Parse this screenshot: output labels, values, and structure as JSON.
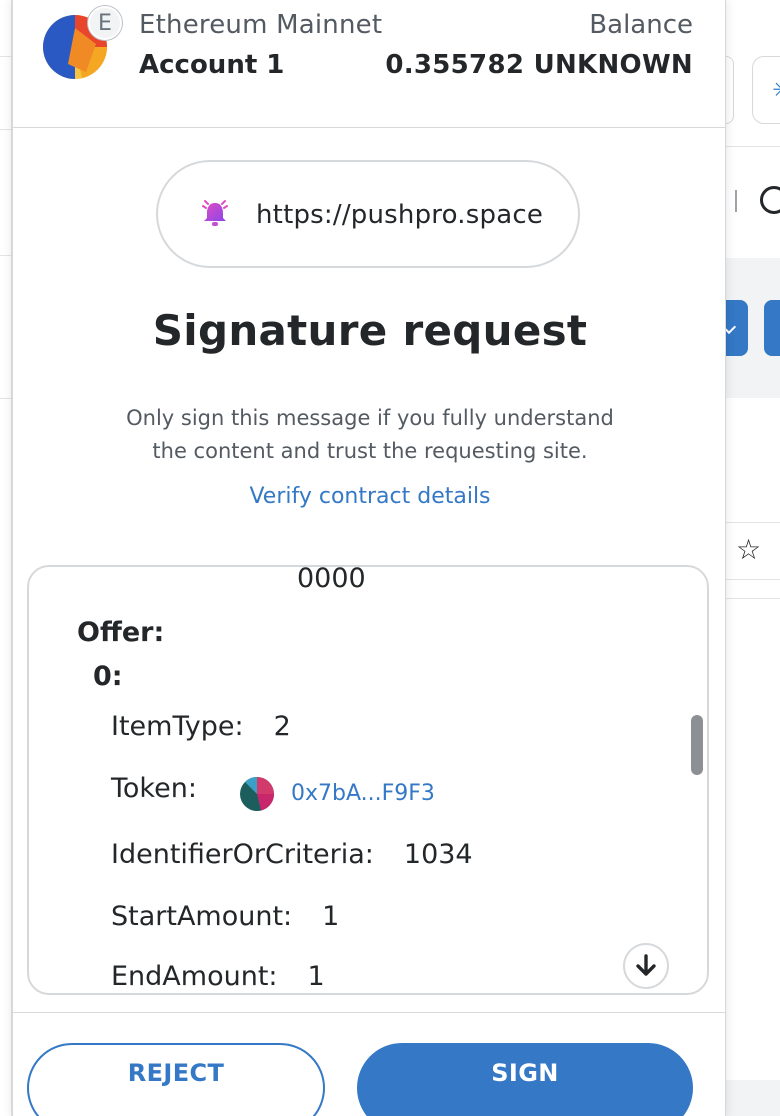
{
  "header": {
    "network_badge": "E",
    "network_name": "Ethereum Mainnet",
    "account_name": "Account 1",
    "balance_label": "Balance",
    "balance_value": "0.355782 UNKNOWN"
  },
  "origin": {
    "url": "https://pushpro.space",
    "icon": "bell-icon"
  },
  "title": "Signature request",
  "warning_line1": "Only sign this message if you fully understand",
  "warning_line2": "the content and trust the requesting site.",
  "verify_link": "Verify contract details",
  "message": {
    "prev_value": "0000",
    "section_label": "Offer:",
    "index_label": "0:",
    "rows": [
      {
        "key": "ItemType:",
        "value": "2"
      },
      {
        "key": "Token:",
        "value": "0x7bA...F9F3"
      },
      {
        "key": "IdentifierOrCriteria:",
        "value": "1034"
      },
      {
        "key": "StartAmount:",
        "value": "1"
      },
      {
        "key": "EndAmount:",
        "value": "1"
      }
    ]
  },
  "buttons": {
    "reject": "REJECT",
    "sign": "SIGN"
  },
  "colors": {
    "primary": "#3478c6",
    "text": "#24272a",
    "muted": "#535a61",
    "border": "#d6d9dc"
  },
  "icons": [
    "metamask-fox-icon",
    "network-e-icon",
    "bell-icon",
    "token-identicon",
    "arrow-down-icon",
    "star-icon"
  ]
}
